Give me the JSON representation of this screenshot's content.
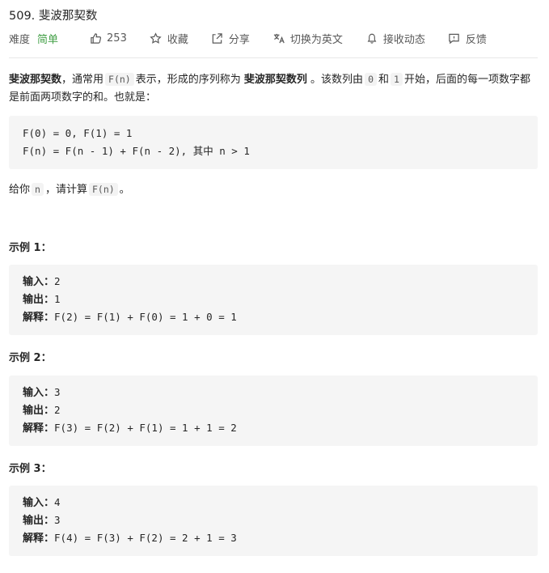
{
  "problem": {
    "title": "509. 斐波那契数",
    "difficulty_label": "难度",
    "difficulty": "简单",
    "likes": "253",
    "favorite": "收藏",
    "share": "分享",
    "switch_lang": "切换为英文",
    "notify": "接收动态",
    "feedback": "反馈"
  },
  "description": {
    "p1_a": "斐波那契数",
    "p1_b": "，通常用",
    "p1_code1": "F(n)",
    "p1_c": "表示，形成的序列称为",
    "p1_d": "斐波那契数列",
    "p1_e": "。该数列由",
    "p1_code2": "0",
    "p1_f": "和",
    "p1_code3": "1",
    "p1_g": "开始，后面的每一项数字都是前面两项数字的和。也就是：",
    "formula_1": "F(0) = 0, F(1) = 1",
    "formula_2a": "F(n) = F(n - 1) + F(n - 2), ",
    "formula_2b": "其中",
    "formula_2c": " n > 1",
    "p2_a": "给你",
    "p2_code1": "n",
    "p2_b": "，请计算",
    "p2_code2": "F(n)",
    "p2_c": "。"
  },
  "labels": {
    "input": "输入：",
    "output": "输出：",
    "explain": "解释："
  },
  "examples": [
    {
      "title": "示例 1：",
      "input": "2",
      "output": "1",
      "explanation": "F(2) = F(1) + F(0) = 1 + 0 = 1"
    },
    {
      "title": "示例 2：",
      "input": "3",
      "output": "2",
      "explanation": "F(3) = F(2) + F(1) = 1 + 1 = 2"
    },
    {
      "title": "示例 3：",
      "input": "4",
      "output": "3",
      "explanation": "F(4) = F(3) + F(2) = 2 + 1 = 3"
    }
  ],
  "colors": {
    "difficulty_easy": "#43a047",
    "code_bg": "#f5f5f5"
  },
  "icons": [
    "thumbs-up-icon",
    "star-icon",
    "share-icon",
    "translate-icon",
    "bell-icon",
    "feedback-icon"
  ]
}
